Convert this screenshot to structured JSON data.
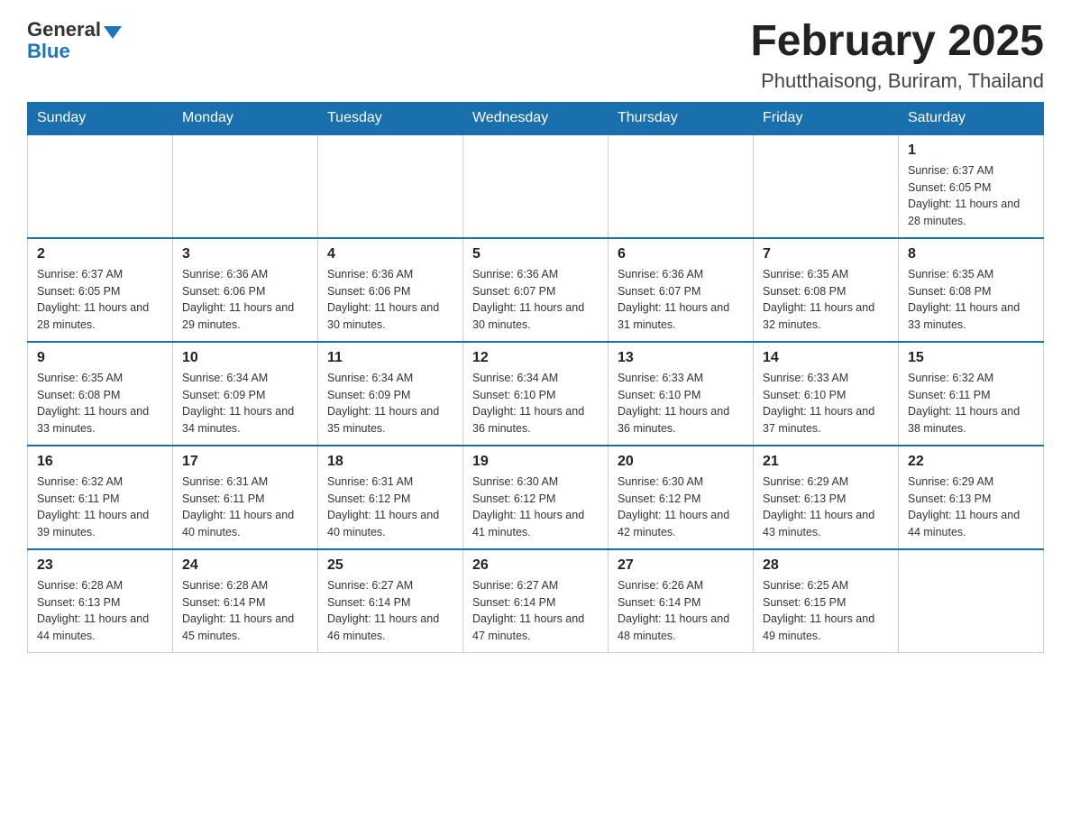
{
  "header": {
    "logo": {
      "general": "General",
      "blue": "Blue"
    },
    "month_title": "February 2025",
    "location": "Phutthaisong, Buriram, Thailand"
  },
  "days_of_week": [
    "Sunday",
    "Monday",
    "Tuesday",
    "Wednesday",
    "Thursday",
    "Friday",
    "Saturday"
  ],
  "weeks": [
    [
      {
        "day": "",
        "info": ""
      },
      {
        "day": "",
        "info": ""
      },
      {
        "day": "",
        "info": ""
      },
      {
        "day": "",
        "info": ""
      },
      {
        "day": "",
        "info": ""
      },
      {
        "day": "",
        "info": ""
      },
      {
        "day": "1",
        "info": "Sunrise: 6:37 AM\nSunset: 6:05 PM\nDaylight: 11 hours and 28 minutes."
      }
    ],
    [
      {
        "day": "2",
        "info": "Sunrise: 6:37 AM\nSunset: 6:05 PM\nDaylight: 11 hours and 28 minutes."
      },
      {
        "day": "3",
        "info": "Sunrise: 6:36 AM\nSunset: 6:06 PM\nDaylight: 11 hours and 29 minutes."
      },
      {
        "day": "4",
        "info": "Sunrise: 6:36 AM\nSunset: 6:06 PM\nDaylight: 11 hours and 30 minutes."
      },
      {
        "day": "5",
        "info": "Sunrise: 6:36 AM\nSunset: 6:07 PM\nDaylight: 11 hours and 30 minutes."
      },
      {
        "day": "6",
        "info": "Sunrise: 6:36 AM\nSunset: 6:07 PM\nDaylight: 11 hours and 31 minutes."
      },
      {
        "day": "7",
        "info": "Sunrise: 6:35 AM\nSunset: 6:08 PM\nDaylight: 11 hours and 32 minutes."
      },
      {
        "day": "8",
        "info": "Sunrise: 6:35 AM\nSunset: 6:08 PM\nDaylight: 11 hours and 33 minutes."
      }
    ],
    [
      {
        "day": "9",
        "info": "Sunrise: 6:35 AM\nSunset: 6:08 PM\nDaylight: 11 hours and 33 minutes."
      },
      {
        "day": "10",
        "info": "Sunrise: 6:34 AM\nSunset: 6:09 PM\nDaylight: 11 hours and 34 minutes."
      },
      {
        "day": "11",
        "info": "Sunrise: 6:34 AM\nSunset: 6:09 PM\nDaylight: 11 hours and 35 minutes."
      },
      {
        "day": "12",
        "info": "Sunrise: 6:34 AM\nSunset: 6:10 PM\nDaylight: 11 hours and 36 minutes."
      },
      {
        "day": "13",
        "info": "Sunrise: 6:33 AM\nSunset: 6:10 PM\nDaylight: 11 hours and 36 minutes."
      },
      {
        "day": "14",
        "info": "Sunrise: 6:33 AM\nSunset: 6:10 PM\nDaylight: 11 hours and 37 minutes."
      },
      {
        "day": "15",
        "info": "Sunrise: 6:32 AM\nSunset: 6:11 PM\nDaylight: 11 hours and 38 minutes."
      }
    ],
    [
      {
        "day": "16",
        "info": "Sunrise: 6:32 AM\nSunset: 6:11 PM\nDaylight: 11 hours and 39 minutes."
      },
      {
        "day": "17",
        "info": "Sunrise: 6:31 AM\nSunset: 6:11 PM\nDaylight: 11 hours and 40 minutes."
      },
      {
        "day": "18",
        "info": "Sunrise: 6:31 AM\nSunset: 6:12 PM\nDaylight: 11 hours and 40 minutes."
      },
      {
        "day": "19",
        "info": "Sunrise: 6:30 AM\nSunset: 6:12 PM\nDaylight: 11 hours and 41 minutes."
      },
      {
        "day": "20",
        "info": "Sunrise: 6:30 AM\nSunset: 6:12 PM\nDaylight: 11 hours and 42 minutes."
      },
      {
        "day": "21",
        "info": "Sunrise: 6:29 AM\nSunset: 6:13 PM\nDaylight: 11 hours and 43 minutes."
      },
      {
        "day": "22",
        "info": "Sunrise: 6:29 AM\nSunset: 6:13 PM\nDaylight: 11 hours and 44 minutes."
      }
    ],
    [
      {
        "day": "23",
        "info": "Sunrise: 6:28 AM\nSunset: 6:13 PM\nDaylight: 11 hours and 44 minutes."
      },
      {
        "day": "24",
        "info": "Sunrise: 6:28 AM\nSunset: 6:14 PM\nDaylight: 11 hours and 45 minutes."
      },
      {
        "day": "25",
        "info": "Sunrise: 6:27 AM\nSunset: 6:14 PM\nDaylight: 11 hours and 46 minutes."
      },
      {
        "day": "26",
        "info": "Sunrise: 6:27 AM\nSunset: 6:14 PM\nDaylight: 11 hours and 47 minutes."
      },
      {
        "day": "27",
        "info": "Sunrise: 6:26 AM\nSunset: 6:14 PM\nDaylight: 11 hours and 48 minutes."
      },
      {
        "day": "28",
        "info": "Sunrise: 6:25 AM\nSunset: 6:15 PM\nDaylight: 11 hours and 49 minutes."
      },
      {
        "day": "",
        "info": ""
      }
    ]
  ]
}
